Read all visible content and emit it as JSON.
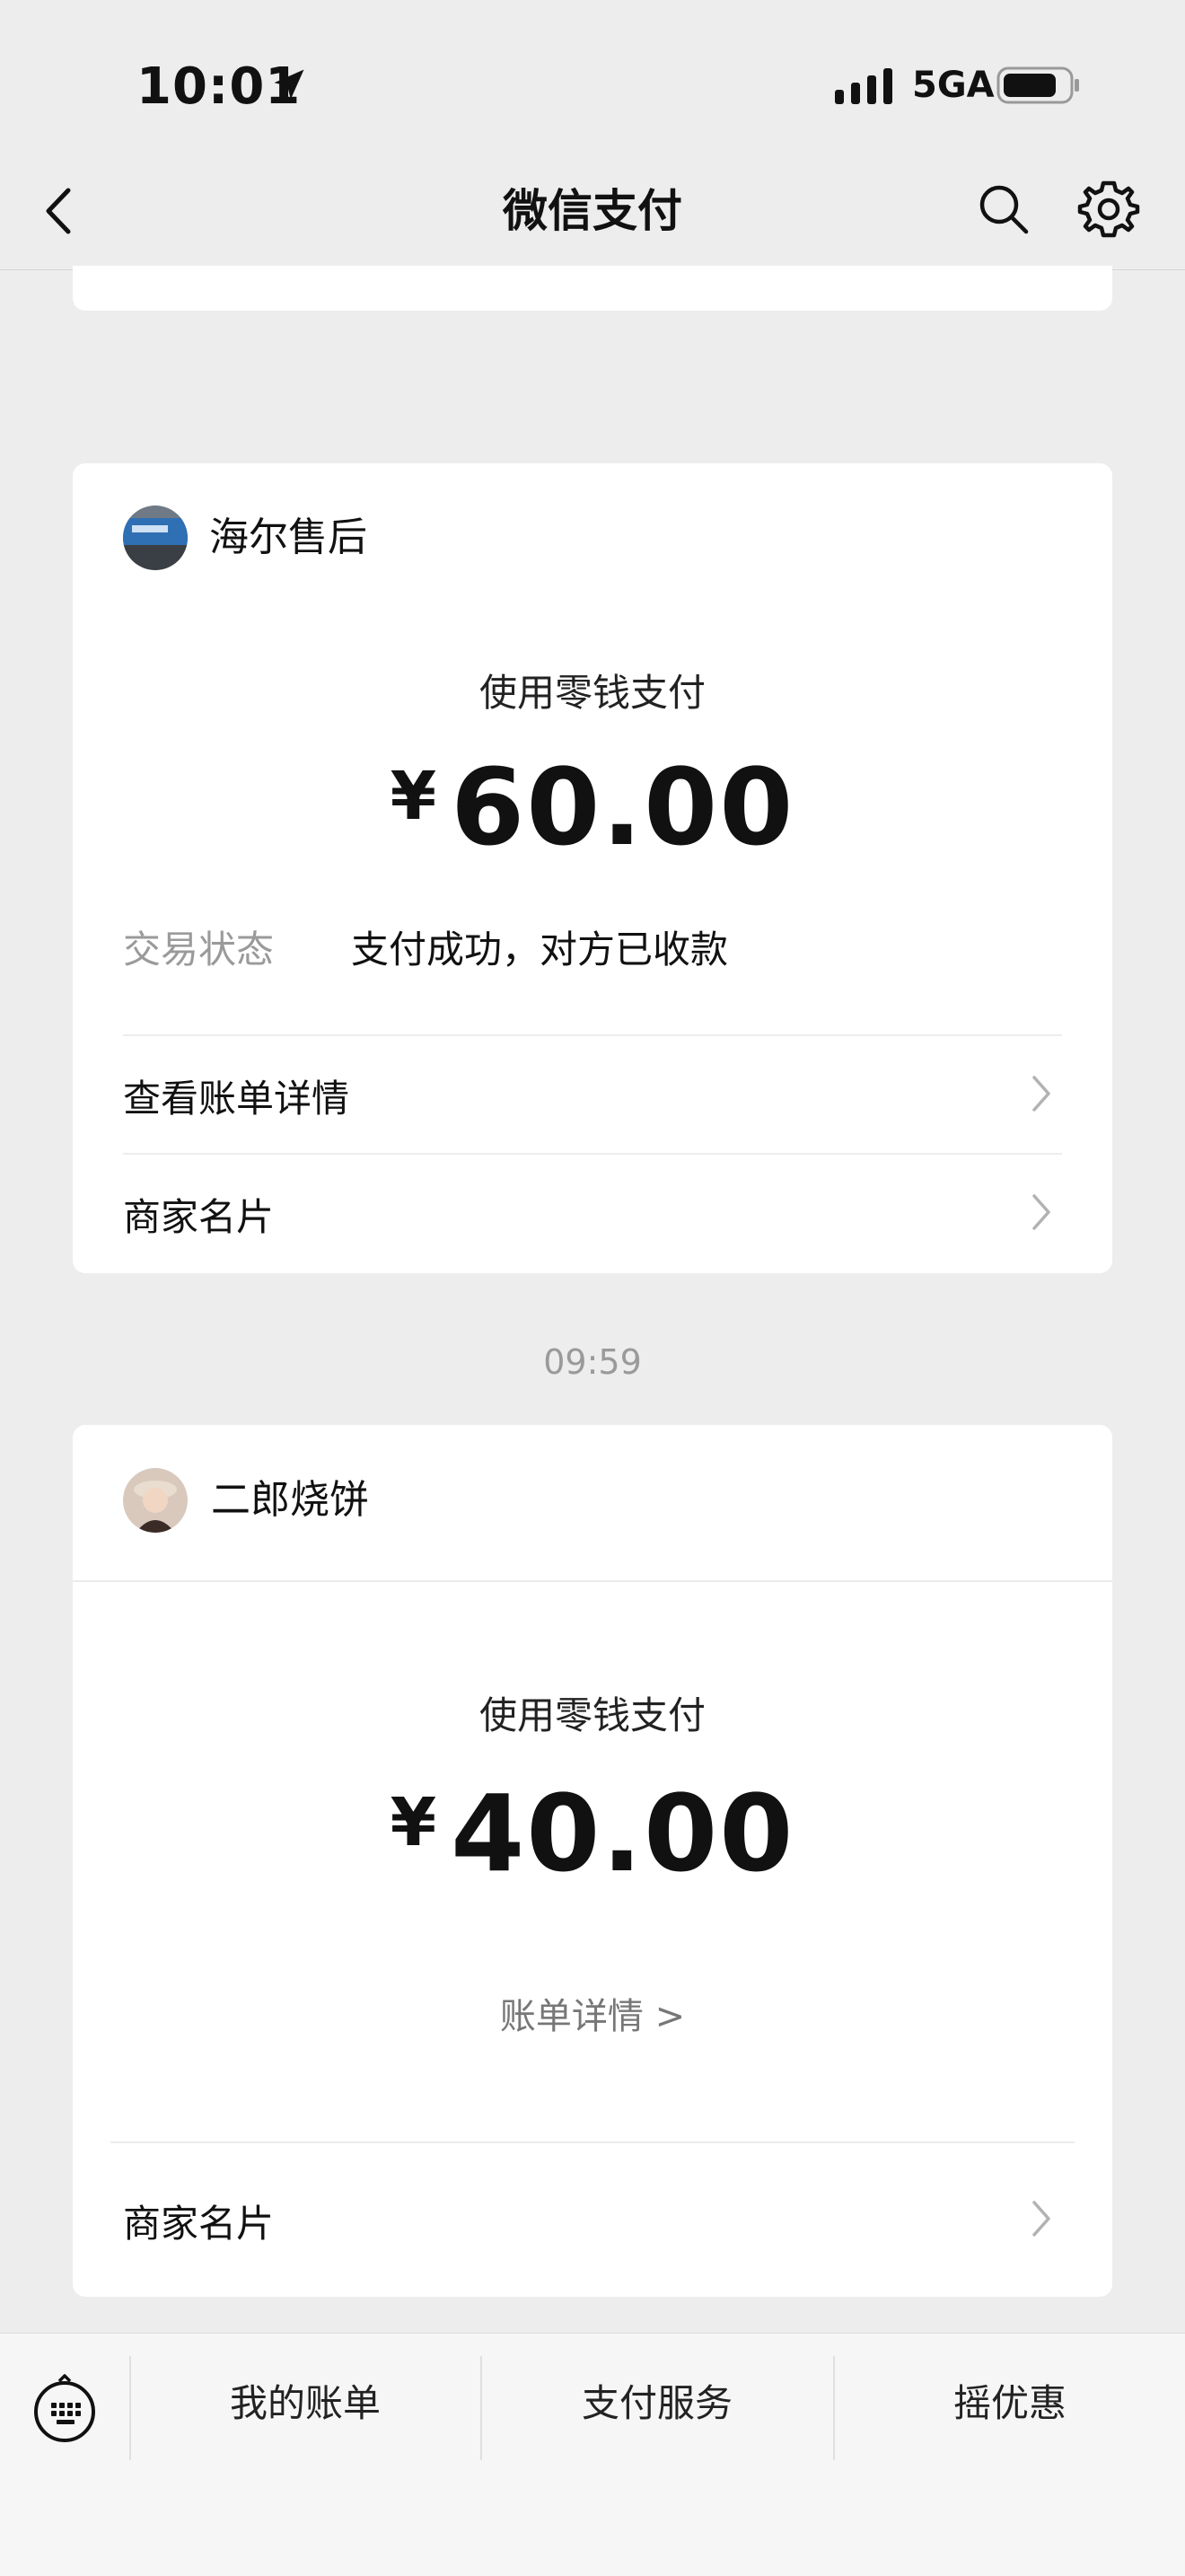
{
  "status_bar": {
    "time": "10:01",
    "network": "5GA"
  },
  "nav": {
    "title": "微信支付"
  },
  "messages": [
    {
      "merchant": "海尔售后",
      "pay_method": "使用零钱支付",
      "currency": "¥",
      "amount": "60.00",
      "status_label": "交易状态",
      "status_value": "支付成功，对方已收款",
      "rows": [
        "查看账单详情",
        "商家名片"
      ]
    },
    {
      "timestamp": "09:59",
      "merchant": "二郎烧饼",
      "pay_method": "使用零钱支付",
      "currency": "¥",
      "amount": "40.00",
      "bill_link": "账单详情 >",
      "rows": [
        "商家名片"
      ]
    }
  ],
  "bottom_bar": {
    "tabs": [
      "我的账单",
      "支付服务",
      "摇优惠"
    ]
  }
}
